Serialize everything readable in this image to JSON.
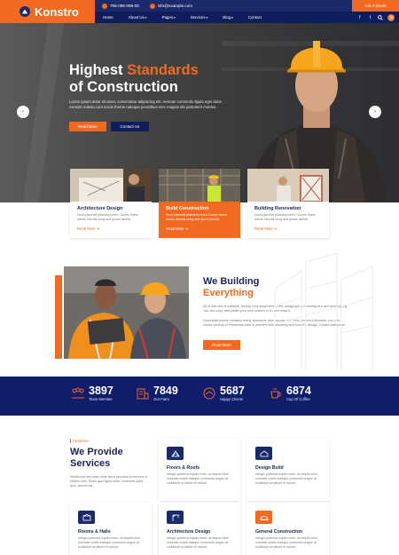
{
  "brand": {
    "name": "Konstro",
    "accent": "#f26a21",
    "navy": "#1b2a6b"
  },
  "topbar": {
    "phone": "786-098-098-09",
    "email": "info@example.com"
  },
  "nav": {
    "items": [
      "Home",
      "About Us",
      "Pages",
      "Services",
      "Blog",
      "Contact"
    ]
  },
  "header": {
    "quote_button": "Get A Quote",
    "social_icons": [
      "facebook-icon",
      "twitter-icon",
      "search-icon",
      "menu-icon"
    ]
  },
  "hero": {
    "title_line1": "Highest",
    "title_accent": "Standards",
    "title_line2": "of Construction",
    "description": "Lorem ipsum dolor sit amet, consectetur adipiscing elit. Aenean commodo ligula eget dolor. Aenean massa cum sociis theme natoque penatibus etec magnis dis parturient montes.",
    "primary_button": "Read More",
    "secondary_button": "Contact Us"
  },
  "services": [
    {
      "title": "Architecture Design",
      "desc": "Nunc placerat pharetra lorem. Donec lorem metus lobortis uring sed ipsum lacinia.",
      "more": "Read More"
    },
    {
      "title": "Build Construction",
      "desc": "Nunc placerat pharetra lorem. Donec lorem metus lobortis uring sed ipsum lacinia.",
      "more": "Read More"
    },
    {
      "title": "Building Renovation",
      "desc": "Nunc placerat pharetra lorem. Donec lorem metus lobortis uring sed ipsum lacinia.",
      "more": "Read More"
    }
  ],
  "about": {
    "title_line1": "We Building",
    "title_accent": "Everything",
    "para1": "All of this text is editable. Simply click anywhere in the paragraph or heading text and start typing. You can copy and paste your own content in to see what it.",
    "para2": "Essentials theme contains many awesome new layouts with very powerful features, you can create vertical or horizontal tabs in minutes with amazing and modern design. Create awesome.",
    "button": "Read More"
  },
  "stats": [
    {
      "value": "3897",
      "label": "Team Member",
      "icon": "team-icon"
    },
    {
      "value": "7849",
      "label": "Our Farm",
      "icon": "building-icon"
    },
    {
      "value": "5687",
      "label": "Happy Clients",
      "icon": "handshake-icon"
    },
    {
      "value": "6874",
      "label": "Cup Of Coffee",
      "icon": "coffee-icon"
    }
  ],
  "features": {
    "tag": "Features",
    "title_line1": "We Provide",
    "title_line2": "Services",
    "description": "Vestibulum sed diam vitae lacus faucibus fermentum a efficitur velit. Etiam quis ligula tortor, venenatis justo quis, laoreet est.",
    "cards": [
      {
        "title": "Floors & Roofs",
        "desc": "Integer placerat sapien enim, at aliquet sem molestie mollis tristique commodo augue at incididunt ut labore et dolore.",
        "icon": "floor-icon"
      },
      {
        "title": "Design Build",
        "desc": "Integer placerat sapien enim, at aliquet sem molestie mollis tristique commodo augue at incididunt ut labore et dolore.",
        "icon": "house-icon"
      },
      {
        "title": "Rooms & Halls",
        "desc": "Integer placerat sapien enim, at aliquet sem molestie mollis tristique commodo augue at incididunt ut labore et dolore.",
        "icon": "room-icon"
      },
      {
        "title": "Architecture Design",
        "desc": "Integer placerat sapien enim, at aliquet sem molestie mollis tristique commodo augue at incididunt ut labore et dolore.",
        "icon": "crane-icon"
      },
      {
        "title": "General Construction",
        "desc": "Integer placerat sapien enim, at aliquet sem molestie mollis tristique commodo augue at incididunt ut labore et dolore.",
        "icon": "helmet-icon"
      }
    ]
  }
}
